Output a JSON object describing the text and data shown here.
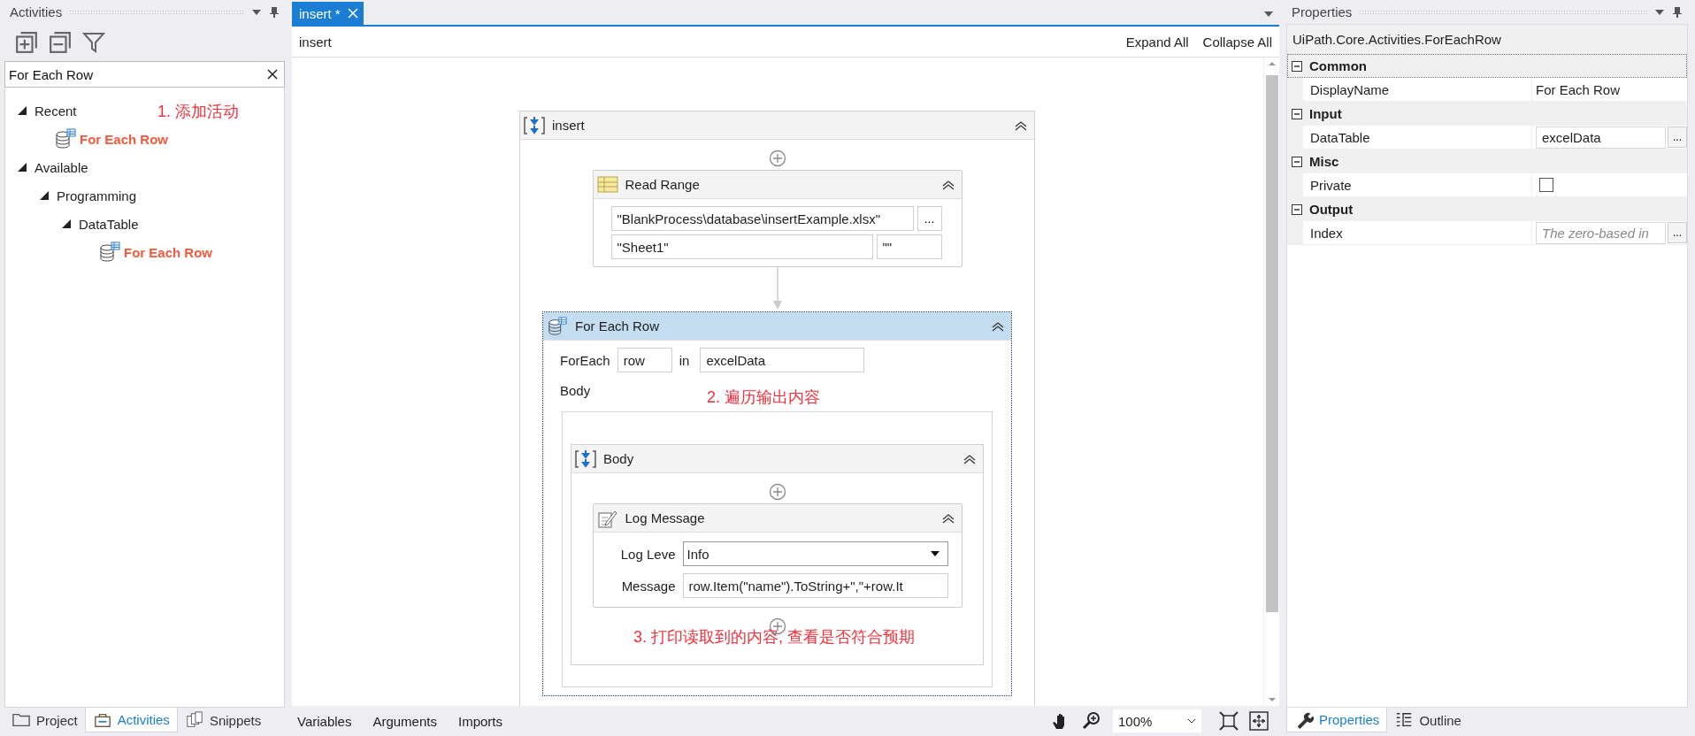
{
  "activities_panel": {
    "title": "Activities",
    "search": {
      "value": "For Each Row"
    },
    "annotation": "1. 添加活动",
    "tree": [
      {
        "label": "Recent",
        "expanded": true,
        "children": [
          {
            "label": "For Each Row",
            "kind": "activity"
          }
        ]
      },
      {
        "label": "Available",
        "expanded": true,
        "children": [
          {
            "label": "Programming",
            "expanded": true,
            "children": [
              {
                "label": "DataTable",
                "expanded": true,
                "children": [
                  {
                    "label": "For Each Row",
                    "kind": "activity"
                  }
                ]
              }
            ]
          }
        ]
      }
    ],
    "tabs": [
      {
        "label": "Project",
        "selected": false
      },
      {
        "label": "Activities",
        "selected": true
      },
      {
        "label": "Snippets",
        "selected": false
      }
    ]
  },
  "designer": {
    "tabs": [
      {
        "label": "insert *",
        "selected": true
      }
    ],
    "breadcrumb": "insert",
    "expand_all": "Expand All",
    "collapse_all": "Collapse All",
    "sequence": {
      "title": "insert",
      "read_range": {
        "title": "Read Range",
        "path": "\"BlankProcess\\database\\insertExample.xlsx\"",
        "browse": "...",
        "sheet": "\"Sheet1\"",
        "range": "\"\""
      },
      "for_each": {
        "title": "For Each Row",
        "selected": true,
        "foreach_label": "ForEach",
        "item": "row",
        "in_label": "in",
        "collection": "excelData",
        "body_label": "Body",
        "annotation": "2. 遍历输出内容",
        "body": {
          "title": "Body",
          "annotation": "3. 打印读取到的内容, 查看是否符合预期",
          "log": {
            "title": "Log Message",
            "level_label": "Log Leve",
            "level": "Info",
            "message_label": "Message",
            "message": "row.Item(\"name\").ToString+\",\"+row.It"
          }
        }
      }
    },
    "bottom_bar": {
      "tabs": [
        "Variables",
        "Arguments",
        "Imports"
      ],
      "zoom": "100%"
    }
  },
  "properties": {
    "title": "Properties",
    "type_name": "UiPath.Core.Activities.ForEachRow",
    "categories": [
      {
        "name": "Common",
        "expanded": true,
        "selected": true,
        "properties": [
          {
            "name": "DisplayName",
            "kind": "text",
            "value": "For Each Row"
          }
        ]
      },
      {
        "name": "Input",
        "expanded": true,
        "selected": false,
        "properties": [
          {
            "name": "DataTable",
            "kind": "expression",
            "value": "excelData",
            "browse": "..."
          }
        ]
      },
      {
        "name": "Misc",
        "expanded": true,
        "selected": false,
        "properties": [
          {
            "name": "Private",
            "kind": "checkbox",
            "checked": false
          }
        ]
      },
      {
        "name": "Output",
        "expanded": true,
        "selected": false,
        "properties": [
          {
            "name": "Index",
            "kind": "expression",
            "placeholder": "The zero-based in",
            "browse": "..."
          }
        ]
      }
    ],
    "tabs": [
      {
        "label": "Properties",
        "selected": true
      },
      {
        "label": "Outline",
        "selected": false
      }
    ]
  }
}
